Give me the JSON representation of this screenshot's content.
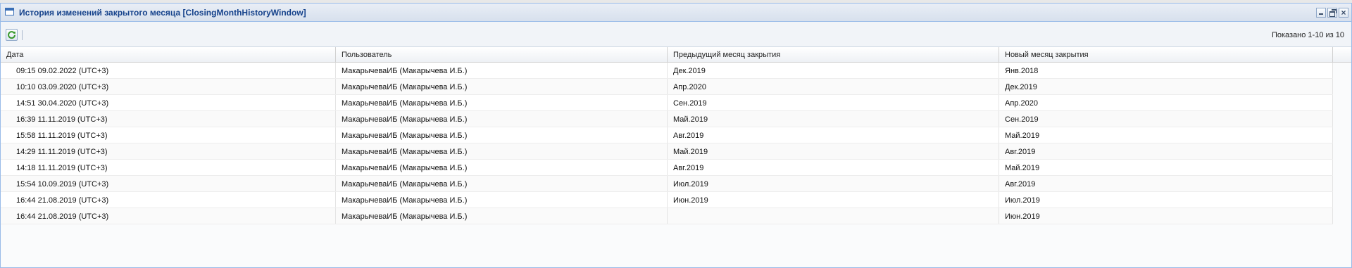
{
  "window": {
    "title": "История изменений закрытого месяца [ClosingMonthHistoryWindow]"
  },
  "toolbar": {
    "paging_text": "Показано 1-10 из 10"
  },
  "table": {
    "columns": [
      "Дата",
      "Пользователь",
      "Предыдущий месяц закрытия",
      "Новый месяц закрытия"
    ],
    "rows": [
      [
        "09:15 09.02.2022 (UTC+3)",
        "МакарычеваИБ (Макарычева И.Б.)",
        "Дек.2019",
        "Янв.2018"
      ],
      [
        "10:10 03.09.2020 (UTC+3)",
        "МакарычеваИБ (Макарычева И.Б.)",
        "Апр.2020",
        "Дек.2019"
      ],
      [
        "14:51 30.04.2020 (UTC+3)",
        "МакарычеваИБ (Макарычева И.Б.)",
        "Сен.2019",
        "Апр.2020"
      ],
      [
        "16:39 11.11.2019 (UTC+3)",
        "МакарычеваИБ (Макарычева И.Б.)",
        "Май.2019",
        "Сен.2019"
      ],
      [
        "15:58 11.11.2019 (UTC+3)",
        "МакарычеваИБ (Макарычева И.Б.)",
        "Авг.2019",
        "Май.2019"
      ],
      [
        "14:29 11.11.2019 (UTC+3)",
        "МакарычеваИБ (Макарычева И.Б.)",
        "Май.2019",
        "Авг.2019"
      ],
      [
        "14:18 11.11.2019 (UTC+3)",
        "МакарычеваИБ (Макарычева И.Б.)",
        "Авг.2019",
        "Май.2019"
      ],
      [
        "15:54 10.09.2019 (UTC+3)",
        "МакарычеваИБ (Макарычева И.Б.)",
        "Июл.2019",
        "Авг.2019"
      ],
      [
        "16:44 21.08.2019 (UTC+3)",
        "МакарычеваИБ (Макарычева И.Б.)",
        "Июн.2019",
        "Июл.2019"
      ],
      [
        "16:44 21.08.2019 (UTC+3)",
        "МакарычеваИБ (Макарычева И.Б.)",
        "",
        "Июн.2019"
      ]
    ]
  },
  "icons": {
    "window": "window-icon",
    "refresh": "refresh-icon",
    "minimize": "minimize-icon",
    "restore": "restore-icon",
    "close": "close-icon"
  },
  "colors": {
    "title_text": "#15428b",
    "border": "#99bbe8",
    "refresh_green": "#3a9a2e"
  }
}
